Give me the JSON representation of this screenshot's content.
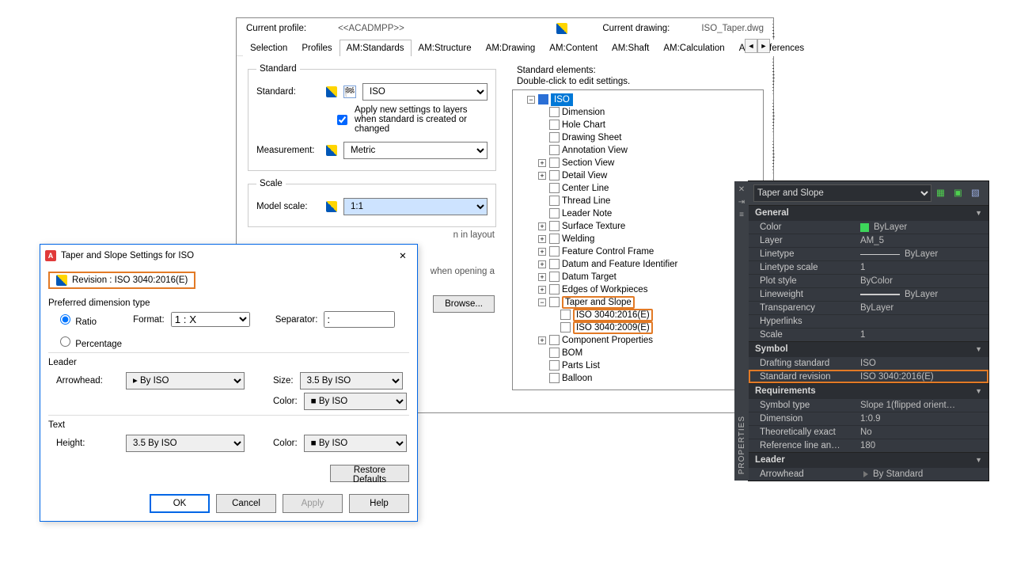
{
  "options": {
    "profile_lbl": "Current profile:",
    "profile_val": "<<ACADMPP>>",
    "drawing_lbl": "Current drawing:",
    "drawing_val": "ISO_Taper.dwg",
    "tabs": [
      "Selection",
      "Profiles",
      "AM:Standards",
      "AM:Structure",
      "AM:Drawing",
      "AM:Content",
      "AM:Shaft",
      "AM:Calculation",
      "AM:Preferences"
    ],
    "active_tab": 2,
    "standard_group": "Standard",
    "standard_lbl": "Standard:",
    "standard_val": "ISO",
    "apply_lbl": "Apply new settings to layers when standard is created or changed",
    "measurement_lbl": "Measurement:",
    "measurement_val": "Metric",
    "scale_group": "Scale",
    "modelscale_lbl": "Model scale:",
    "modelscale_val": "1:1",
    "use11_fragment": "n in layout",
    "open_fragment": "when opening a",
    "browse_btn": "Browse...",
    "elements_lbl": "Standard elements:",
    "elements_hint": "Double-click to edit settings.",
    "tree": {
      "root": "ISO",
      "items": [
        "Dimension",
        "Hole Chart",
        "Drawing Sheet",
        "Annotation View",
        "Section View",
        "Detail View",
        "Center Line",
        "Thread Line",
        "Leader Note",
        "Surface Texture",
        "Welding",
        "Feature Control Frame",
        "Datum and Feature Identifier",
        "Datum Target",
        "Edges of Workpieces",
        "Taper and Slope",
        "Component Properties",
        "BOM",
        "Parts List",
        "Balloon"
      ],
      "taper_children": [
        "ISO 3040:2016(E)",
        "ISO 3040:2009(E)"
      ]
    }
  },
  "modal": {
    "title": "Taper and Slope Settings for ISO",
    "revision": "Revision : ISO 3040:2016(E)",
    "pref_label": "Preferred dimension type",
    "ratio_lbl": "Ratio",
    "percentage_lbl": "Percentage",
    "format_lbl": "Format:",
    "format_val": "1 : X",
    "separator_lbl": "Separator:",
    "separator_val": ":",
    "leader_group": "Leader",
    "arrowhead_lbl": "Arrowhead:",
    "arrowhead_val": "By ISO",
    "size_lbl": "Size:",
    "size_val": "3.5  By ISO",
    "color_lbl": "Color:",
    "color_val": "By ISO",
    "text_group": "Text",
    "height_lbl": "Height:",
    "height_val": "3.5  By ISO",
    "restore_btn": "Restore Defaults",
    "ok_btn": "OK",
    "cancel_btn": "Cancel",
    "apply_btn": "Apply",
    "help_btn": "Help"
  },
  "palette": {
    "selector": "Taper and Slope",
    "vlabel": "PROPERTIES",
    "groups": [
      {
        "name": "General",
        "rows": [
          {
            "k": "Color",
            "v": "ByLayer",
            "sw": true
          },
          {
            "k": "Layer",
            "v": "AM_5"
          },
          {
            "k": "Linetype",
            "v": "ByLayer",
            "line": "lt"
          },
          {
            "k": "Linetype scale",
            "v": "1"
          },
          {
            "k": "Plot style",
            "v": "ByColor"
          },
          {
            "k": "Lineweight",
            "v": "ByLayer",
            "line": "lw"
          },
          {
            "k": "Transparency",
            "v": "ByLayer"
          },
          {
            "k": "Hyperlinks",
            "v": ""
          },
          {
            "k": "Scale",
            "v": "1"
          }
        ]
      },
      {
        "name": "Symbol",
        "rows": [
          {
            "k": "Drafting standard",
            "v": "ISO"
          },
          {
            "k": "Standard revision",
            "v": "ISO 3040:2016(E)",
            "hl": true
          }
        ]
      },
      {
        "name": "Requirements",
        "rows": [
          {
            "k": "Symbol type",
            "v": "Slope 1(flipped orient…"
          },
          {
            "k": "Dimension",
            "v": "1:0.9"
          },
          {
            "k": "Theoretically exact",
            "v": "No"
          },
          {
            "k": "Reference line an…",
            "v": "180"
          }
        ]
      },
      {
        "name": "Leader",
        "rows": [
          {
            "k": "Arrowhead",
            "v": "By Standard",
            "arw": true
          }
        ]
      }
    ]
  }
}
